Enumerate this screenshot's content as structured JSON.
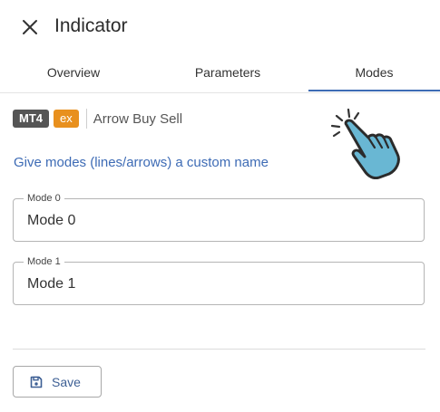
{
  "header": {
    "title": "Indicator",
    "close_icon": "close-icon"
  },
  "tabs": [
    {
      "label": "Overview",
      "active": false
    },
    {
      "label": "Parameters",
      "active": false
    },
    {
      "label": "Modes",
      "active": true
    }
  ],
  "indicator": {
    "platform_badge": "MT4",
    "type_badge": "ex",
    "name": "Arrow Buy Sell"
  },
  "hint_text": "Give modes (lines/arrows) a custom name",
  "modes": [
    {
      "legend": "Mode 0",
      "value": "Mode 0"
    },
    {
      "legend": "Mode 1",
      "value": "Mode 1"
    }
  ],
  "save_button": {
    "label": "Save",
    "icon": "floppy-disk-icon"
  },
  "colors": {
    "accent": "#3d6bb5",
    "badge_mt4": "#555555",
    "badge_ex": "#e8901e",
    "pointer_fill": "#69b7d3"
  },
  "decor": {
    "pointer_icon": "pointing-hand-cursor-icon"
  }
}
